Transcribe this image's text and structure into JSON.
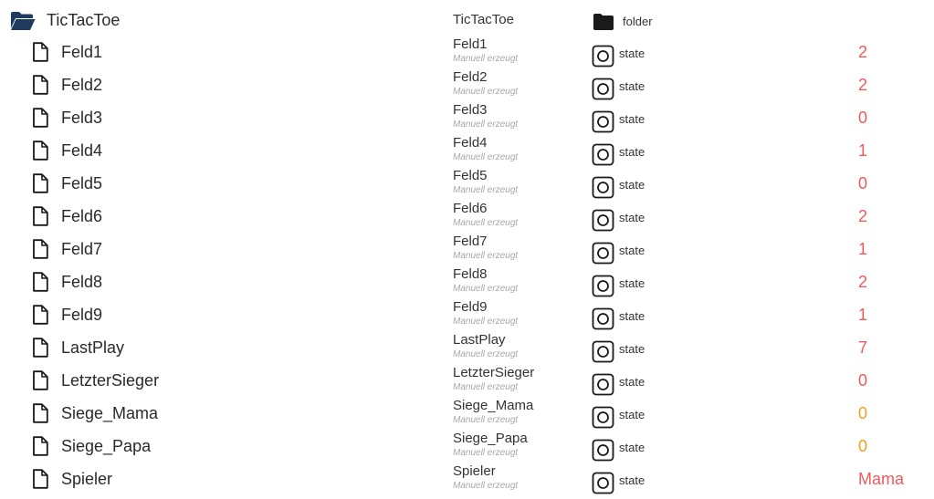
{
  "colors": {
    "folder_icon": "#1f3a5f",
    "value_red": "#f05a5a",
    "value_orange": "#f0a11e",
    "description": "#a8a8a8"
  },
  "folder": {
    "name": "TicTacToe",
    "title": "TicTacToe",
    "type": "folder",
    "icon": "folder-open-icon",
    "type_icon": "folder-icon"
  },
  "states": [
    {
      "name": "Feld1",
      "title": "Feld1",
      "description": "Manuell erzeugt",
      "type": "state",
      "value": "2",
      "value_color": "red"
    },
    {
      "name": "Feld2",
      "title": "Feld2",
      "description": "Manuell erzeugt",
      "type": "state",
      "value": "2",
      "value_color": "red"
    },
    {
      "name": "Feld3",
      "title": "Feld3",
      "description": "Manuell erzeugt",
      "type": "state",
      "value": "0",
      "value_color": "red"
    },
    {
      "name": "Feld4",
      "title": "Feld4",
      "description": "Manuell erzeugt",
      "type": "state",
      "value": "1",
      "value_color": "red"
    },
    {
      "name": "Feld5",
      "title": "Feld5",
      "description": "Manuell erzeugt",
      "type": "state",
      "value": "0",
      "value_color": "red"
    },
    {
      "name": "Feld6",
      "title": "Feld6",
      "description": "Manuell erzeugt",
      "type": "state",
      "value": "2",
      "value_color": "red"
    },
    {
      "name": "Feld7",
      "title": "Feld7",
      "description": "Manuell erzeugt",
      "type": "state",
      "value": "1",
      "value_color": "red"
    },
    {
      "name": "Feld8",
      "title": "Feld8",
      "description": "Manuell erzeugt",
      "type": "state",
      "value": "2",
      "value_color": "red"
    },
    {
      "name": "Feld9",
      "title": "Feld9",
      "description": "Manuell erzeugt",
      "type": "state",
      "value": "1",
      "value_color": "red"
    },
    {
      "name": "LastPlay",
      "title": "LastPlay",
      "description": "Manuell erzeugt",
      "type": "state",
      "value": "7",
      "value_color": "red"
    },
    {
      "name": "LetzterSieger",
      "title": "LetzterSieger",
      "description": "Manuell erzeugt",
      "type": "state",
      "value": "0",
      "value_color": "red"
    },
    {
      "name": "Siege_Mama",
      "title": "Siege_Mama",
      "description": "Manuell erzeugt",
      "type": "state",
      "value": "0",
      "value_color": "orange"
    },
    {
      "name": "Siege_Papa",
      "title": "Siege_Papa",
      "description": "Manuell erzeugt",
      "type": "state",
      "value": "0",
      "value_color": "orange"
    },
    {
      "name": "Spieler",
      "title": "Spieler",
      "description": "Manuell erzeugt",
      "type": "state",
      "value": "Mama",
      "value_color": "red"
    }
  ]
}
